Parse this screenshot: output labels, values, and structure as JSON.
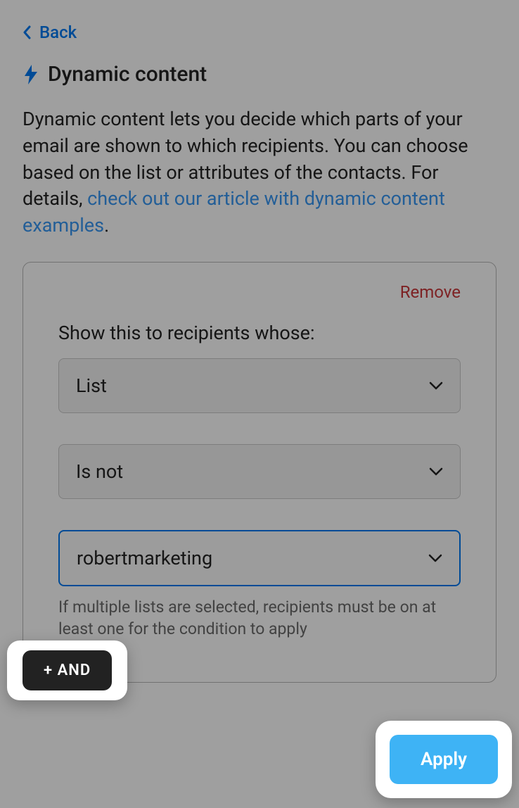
{
  "back": {
    "label": "Back"
  },
  "header": {
    "title": "Dynamic content"
  },
  "description": {
    "text_before": "Dynamic content lets you decide which parts of your email are shown to which recipients. You can choose based on the list or attributes of the contacts. For details, ",
    "link_text": "check out our article with dynamic content examples",
    "text_after": "."
  },
  "condition": {
    "remove_label": "Remove",
    "prompt": "Show this to recipients whose:",
    "field_select": "List",
    "operator_select": "Is not",
    "value_select": "robertmarketing",
    "helper": "If multiple lists are selected, recipients must be on at least one for the condition to apply"
  },
  "actions": {
    "and_button": "+ AND",
    "apply_button": "Apply"
  }
}
